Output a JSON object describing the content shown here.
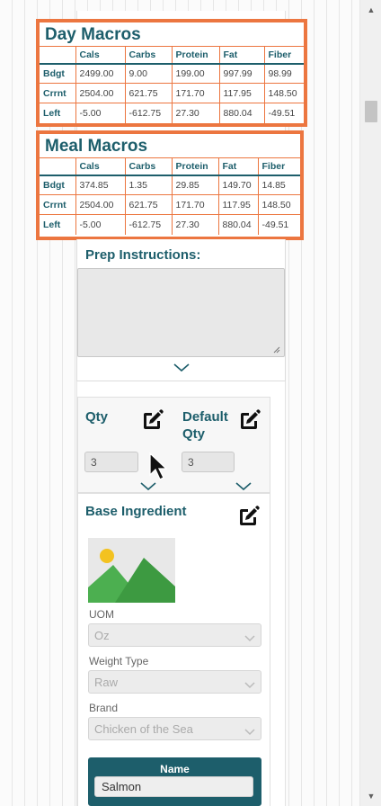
{
  "scrollbar": {
    "up_arrow": "▲",
    "down_arrow": "▼"
  },
  "day_macros": {
    "title": "Day Macros",
    "columns": [
      "",
      "Cals",
      "Carbs",
      "Protein",
      "Fat",
      "Fiber"
    ],
    "rows": [
      {
        "label": "Bdgt",
        "values": [
          "2499.00",
          "9.00",
          "199.00",
          "997.99",
          "98.99"
        ]
      },
      {
        "label": "Crrnt",
        "values": [
          "2504.00",
          "621.75",
          "171.70",
          "117.95",
          "148.50"
        ]
      },
      {
        "label": "Left",
        "values": [
          "-5.00",
          "-612.75",
          "27.30",
          "880.04",
          "-49.51"
        ]
      }
    ]
  },
  "meal_macros": {
    "title": "Meal Macros",
    "columns": [
      "",
      "Cals",
      "Carbs",
      "Protein",
      "Fat",
      "Fiber"
    ],
    "rows": [
      {
        "label": "Bdgt",
        "values": [
          "374.85",
          "1.35",
          "29.85",
          "149.70",
          "14.85"
        ]
      },
      {
        "label": "Crrnt",
        "values": [
          "2504.00",
          "621.75",
          "171.70",
          "117.95",
          "148.50"
        ]
      },
      {
        "label": "Left",
        "values": [
          "-5.00",
          "-612.75",
          "27.30",
          "880.04",
          "-49.51"
        ]
      }
    ]
  },
  "prep": {
    "label": "Prep Instructions:",
    "value": ""
  },
  "qty": {
    "qty_label": "Qty",
    "qty_value": "3",
    "default_label_line1": "Default",
    "default_label_line2": "Qty",
    "default_value": "3"
  },
  "base_ingredient": {
    "label": "Base Ingredient",
    "uom_label": "UOM",
    "uom_value": "Oz",
    "weight_type_label": "Weight Type",
    "weight_type_value": "Raw",
    "brand_label": "Brand",
    "brand_value": "Chicken of the Sea",
    "name_header": "Name",
    "name_value": "Salmon"
  },
  "colors": {
    "accent_orange": "#ec7640",
    "teal": "#1d5e6b"
  },
  "icons": [
    "edit-icon",
    "chevron-down-icon",
    "image-placeholder-icon",
    "cursor-arrow-icon"
  ]
}
